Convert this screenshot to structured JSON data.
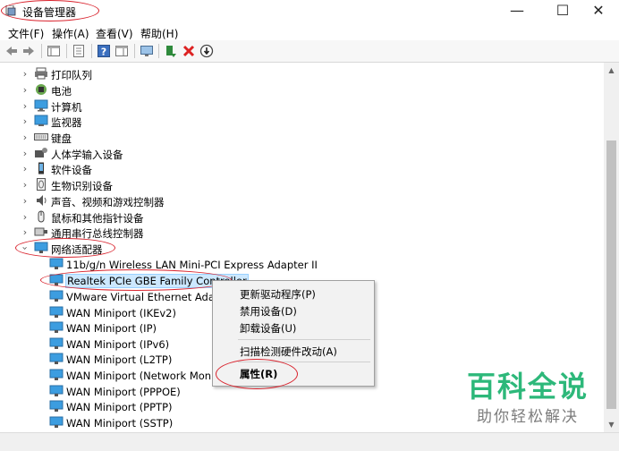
{
  "window": {
    "title": "设备管理器"
  },
  "caption_buttons": {
    "minimize": "—",
    "maximize": "☐",
    "close": "✕"
  },
  "menu": [
    "文件(F)",
    "操作(A)",
    "查看(V)",
    "帮助(H)"
  ],
  "toolbar": {
    "icons": [
      "back-icon",
      "forward-icon",
      "show-hide-console-tree-icon",
      "properties-icon",
      "help-icon",
      "action-pane-icon",
      "monitor-icon",
      "update-driver-icon",
      "uninstall-icon",
      "disable-icon"
    ]
  },
  "tree": {
    "categories": [
      {
        "label": "打印队列",
        "icon": "print-queue-icon",
        "expanded": false
      },
      {
        "label": "电池",
        "icon": "battery-icon",
        "expanded": false
      },
      {
        "label": "计算机",
        "icon": "computer-icon",
        "expanded": false
      },
      {
        "label": "监视器",
        "icon": "monitor-icon",
        "expanded": false
      },
      {
        "label": "键盘",
        "icon": "keyboard-icon",
        "expanded": false
      },
      {
        "label": "人体学输入设备",
        "icon": "human-interface-device-icon",
        "expanded": false
      },
      {
        "label": "软件设备",
        "icon": "software-device-icon",
        "expanded": false
      },
      {
        "label": "生物识别设备",
        "icon": "biometric-device-icon",
        "expanded": false
      },
      {
        "label": "声音、视频和游戏控制器",
        "icon": "sound-icon",
        "expanded": false
      },
      {
        "label": "鼠标和其他指针设备",
        "icon": "mouse-icon",
        "expanded": false
      },
      {
        "label": "通用串行总线控制器",
        "icon": "usb-controller-icon",
        "expanded": false
      },
      {
        "label": "网络适配器",
        "icon": "network-adapter-icon",
        "expanded": true
      }
    ],
    "adapters": [
      "11b/g/n  Wireless LAN Mini-PCI Express Adapter II",
      "Realtek PCIe GBE Family Controller",
      "VMware Virtual Ethernet Adapter",
      "WAN Miniport (IKEv2)",
      "WAN Miniport (IP)",
      "WAN Miniport (IPv6)",
      "WAN Miniport (L2TP)",
      "WAN Miniport (Network Monitor)",
      "WAN Miniport (PPPOE)",
      "WAN Miniport (PPTP)",
      "WAN Miniport (SSTP)"
    ],
    "selected_adapter": "Realtek PCIe GBE Family Controller"
  },
  "context_menu": {
    "items": [
      "更新驱动程序(P)",
      "禁用设备(D)",
      "卸载设备(U)",
      "扫描检测硬件改动(A)",
      "属性(R)"
    ]
  },
  "watermark": {
    "title": "百科全说",
    "subtitle": "助你轻松解决"
  },
  "colors": {
    "accent": "#2db87a",
    "annotation": "#d9232d",
    "selection": "#cce8ff"
  }
}
